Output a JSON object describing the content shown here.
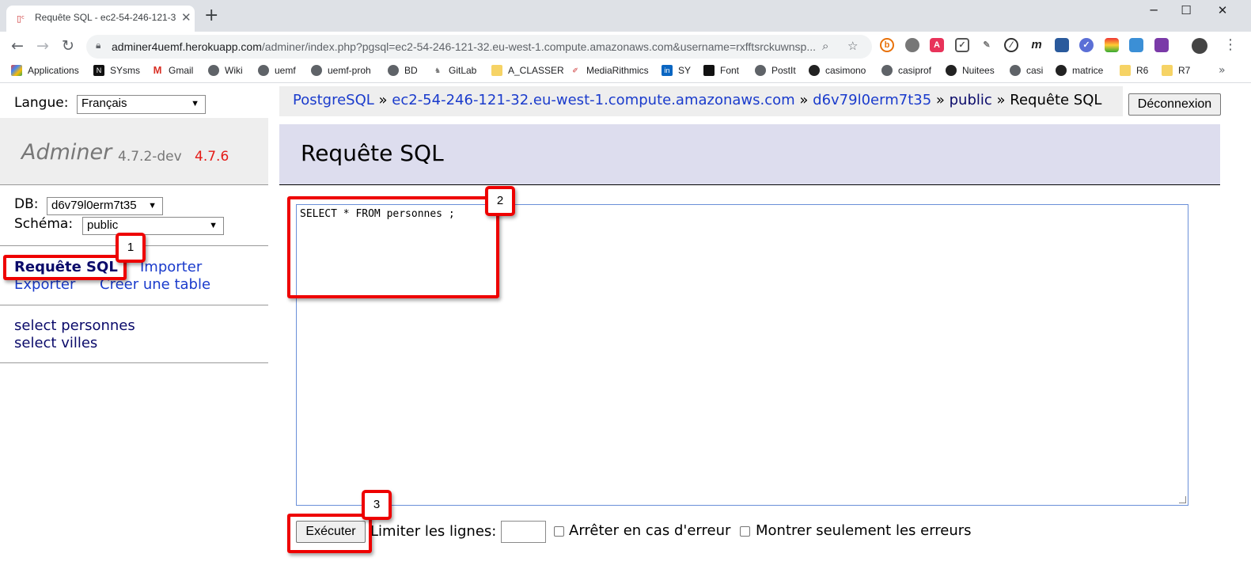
{
  "browser": {
    "tab_title": "Requête SQL - ec2-54-246-121-3",
    "url_main": "adminer4uemf.herokuapp.com",
    "url_rest": "/adminer/index.php?pgsql=ec2-54-246-121-32.eu-west-1.compute.amazonaws.com&username=rxfftsrckuwnsp...",
    "bookmarks": [
      "Applications",
      "SYsms",
      "Gmail",
      "Wiki",
      "uemf",
      "uemf-proh",
      "BD",
      "GitLab",
      "A_CLASSER",
      "MediaRithmics",
      "SY",
      "Font",
      "PostIt",
      "casimono",
      "casiprof",
      "Nuitees",
      "casi",
      "matrice",
      "R6",
      "R7"
    ]
  },
  "adminer": {
    "lang_label": "Langue:",
    "lang_value": "Français",
    "brand_name": "Adminer",
    "version": "4.7.2-dev",
    "new_version": "4.7.6",
    "db_label": "DB:",
    "db_value": "d6v79l0erm7t35",
    "schema_label": "Schéma:",
    "schema_value": "public",
    "links": {
      "sql": "Requête SQL",
      "import": "Importer",
      "export": "Exporter",
      "create_table": "Créer une table"
    },
    "tables": [
      "select personnes",
      "select villes"
    ],
    "breadcrumb": {
      "driver": "PostgreSQL",
      "sep": " » ",
      "server": "ec2-54-246-121-32.eu-west-1.compute.amazonaws.com",
      "database": "d6v79l0erm7t35",
      "schema": "public",
      "current": "Requête SQL"
    },
    "logout_label": "Déconnexion",
    "page_title": "Requête SQL",
    "sql_query": "SELECT * FROM personnes ;",
    "execute_label": "Exécuter",
    "limit_label": "Limiter les lignes:",
    "stop_on_error_label": "Arrêter en cas d'erreur",
    "only_errors_label": "Montrer seulement les erreurs"
  },
  "annotations": {
    "step1": "1",
    "step2": "2",
    "step3": "3",
    "color": "#e00000"
  }
}
